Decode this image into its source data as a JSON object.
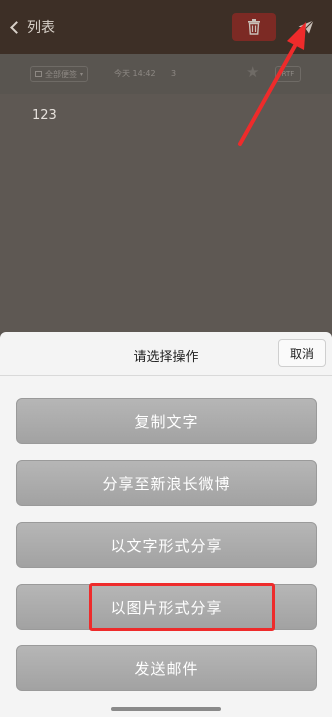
{
  "nav": {
    "back_label": "列表"
  },
  "note": {
    "folder_label": "全部便签",
    "time_label": "今天 14:42",
    "count_label": "3",
    "format_label": "RTF",
    "content": "123"
  },
  "sheet": {
    "title": "请选择操作",
    "cancel_label": "取消",
    "actions": [
      {
        "label": "复制文字"
      },
      {
        "label": "分享至新浪长微博"
      },
      {
        "label": "以文字形式分享"
      },
      {
        "label": "以图片形式分享"
      },
      {
        "label": "发送邮件"
      }
    ]
  },
  "colors": {
    "annotation": "#ee2b2b",
    "action_button": "#a8a8a8",
    "topbar": "#3d2f26",
    "delete_button": "#7c2a24"
  },
  "icons": [
    "chevron-left-icon",
    "trash-icon",
    "send-icon",
    "star-icon",
    "folder-icon"
  ]
}
